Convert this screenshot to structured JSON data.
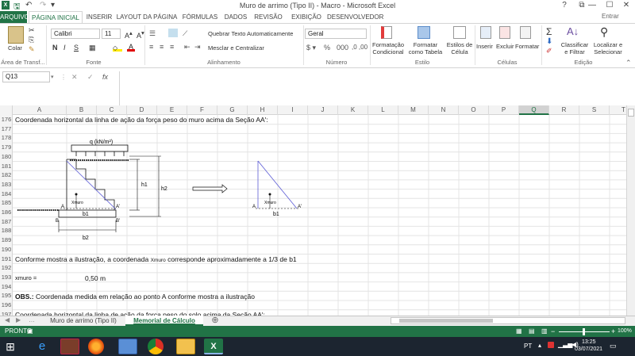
{
  "window": {
    "title": "Muro de arrimo (Tipo II) - Macro - Microsoft Excel",
    "help": "?",
    "restore": "⧉",
    "minimize": "—",
    "maximize": "☐",
    "close": "✕",
    "signin": "Entrar"
  },
  "quick_access": {
    "save": "🖫",
    "undo": "↶",
    "redo": "↷",
    "more": "▾"
  },
  "tabs": [
    "ARQUIVO",
    "PÁGINA INICIAL",
    "INSERIR",
    "LAYOUT DA PÁGINA",
    "FÓRMULAS",
    "DADOS",
    "REVISÃO",
    "EXIBIÇÃO",
    "DESENVOLVEDOR"
  ],
  "ribbon": {
    "paste": "Colar",
    "font_name": "Calibri",
    "font_size": "11",
    "bold": "N",
    "italic": "I",
    "underline": "S",
    "wrap_text": "Quebrar Texto Automaticamente",
    "merge": "Mesclar e Centralizar",
    "number_format": "Geral",
    "cond_format": "Formatação Condicional",
    "format_table": "Formatar como Tabela",
    "cell_styles": "Estilos de Célula",
    "insert": "Inserir",
    "delete": "Excluir",
    "format": "Formatar",
    "sort_filter": "Classificar e Filtrar",
    "find_select": "Localizar e Selecionar",
    "groups": [
      "Área de Transf...",
      "Fonte",
      "Alinhamento",
      "Número",
      "Estilo",
      "Células",
      "Edição"
    ]
  },
  "formula_bar": {
    "name_box": "Q13",
    "fx": "fx",
    "cancel": "✕",
    "enter": "✓",
    "content": ""
  },
  "columns": [
    "A",
    "B",
    "C",
    "D",
    "E",
    "F",
    "G",
    "H",
    "I",
    "J",
    "K",
    "L",
    "M",
    "N",
    "O",
    "P",
    "Q",
    "R",
    "S",
    "T"
  ],
  "rows": [
    "176",
    "177",
    "178",
    "179",
    "180",
    "181",
    "182",
    "183",
    "184",
    "185",
    "186",
    "187",
    "188",
    "189",
    "190",
    "191",
    "192",
    "193",
    "194",
    "195",
    "196",
    "197"
  ],
  "cells": {
    "r176": "Coordenada horizontal da linha de ação da força peso do muro acima da Seção AA':",
    "r191": "Conforme mostra a ilustração, a coordenada",
    "r191_small": "Xmuro",
    "r191_end": "corresponde aproximadamente a 1/3 de b1",
    "r193_label": "xmuro =",
    "r193_value": "0,50",
    "r193_unit": "m",
    "r195_bold": "OBS.:",
    "r195_text": "Coordenada medida em relação ao ponto A conforme mostra a ilustração",
    "r197": "Coordenada horizontal da linha de ação da força peso do solo acima da Seção AA':"
  },
  "diagram": {
    "load": "q (kN/m²)",
    "h1": "h1",
    "h2": "h2",
    "b1": "b1",
    "b2": "b2",
    "A": "A",
    "A2": "A'",
    "B": "B",
    "B2": "B'",
    "xmuro": "Xmuro"
  },
  "sheets": [
    "Muro de arrimo (Tipo II)",
    "Memorial de Cálculo"
  ],
  "active_sheet": "Memorial de Cálculo",
  "status": {
    "mode": "PRONTO",
    "zoom": "100%"
  },
  "taskbar": {
    "lang": "PT",
    "time": "13:25",
    "date": "03/07/2021"
  },
  "colors": {
    "excel_green": "#217346",
    "taskbar": "#1c2530",
    "diagram_line": "#5b5bd6"
  }
}
